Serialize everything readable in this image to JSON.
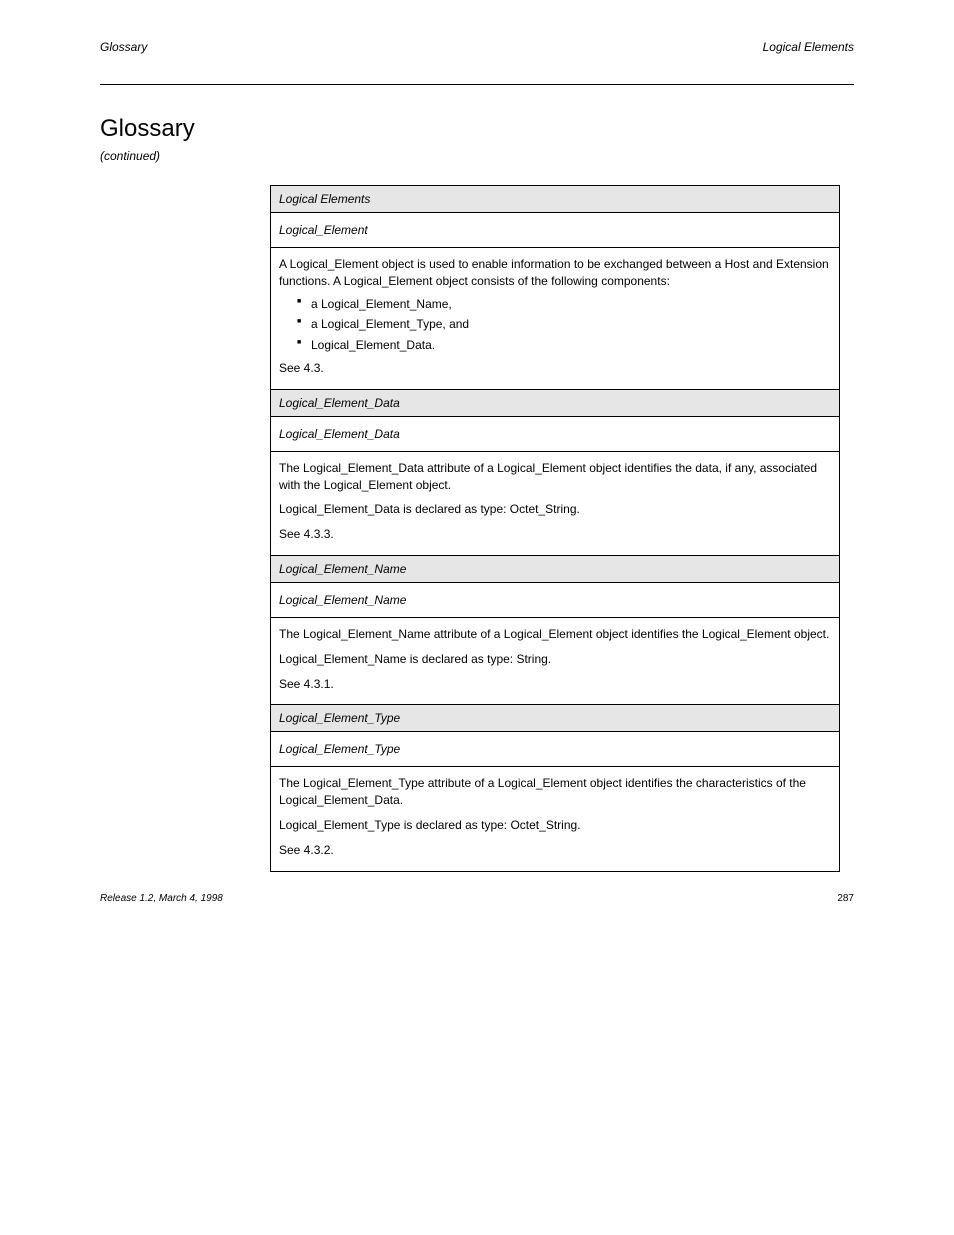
{
  "header": {
    "left": "Glossary",
    "right": "Logical Elements"
  },
  "title": "Glossary",
  "subtitle": "(continued)",
  "sections": [
    {
      "heading": "Logical Elements",
      "term": "Logical_Element",
      "def_lead": "A Logical_Element object is used to enable information to be exchanged between a Host and Extension functions. A Logical_Element object consists of the following components:",
      "def_bullets": [
        "a Logical_Element_Name,",
        "a Logical_Element_Type, and",
        "Logical_Element_Data."
      ],
      "def_tail": "See 4.3."
    },
    {
      "heading": "Logical_Element_Data",
      "term": "Logical_Element_Data",
      "def_paragraphs": [
        "The Logical_Element_Data attribute of a Logical_Element object identifies the data, if any, associated with the Logical_Element object.",
        "Logical_Element_Data is declared as type: Octet_String.",
        "See 4.3.3."
      ]
    },
    {
      "heading": "Logical_Element_Name",
      "term": "Logical_Element_Name",
      "def_paragraphs": [
        "The Logical_Element_Name attribute of a Logical_Element object identifies the Logical_Element object.",
        "Logical_Element_Name is declared as type: String.",
        "See 4.3.1."
      ]
    },
    {
      "heading": "Logical_Element_Type",
      "term": "Logical_Element_Type",
      "def_paragraphs": [
        "The Logical_Element_Type attribute of a Logical_Element object identifies the characteristics of the Logical_Element_Data.",
        "Logical_Element_Type is declared as type: Octet_String.",
        "See 4.3.2."
      ]
    }
  ],
  "footer": {
    "left": "Release 1.2, March 4, 1998",
    "right": "287"
  }
}
